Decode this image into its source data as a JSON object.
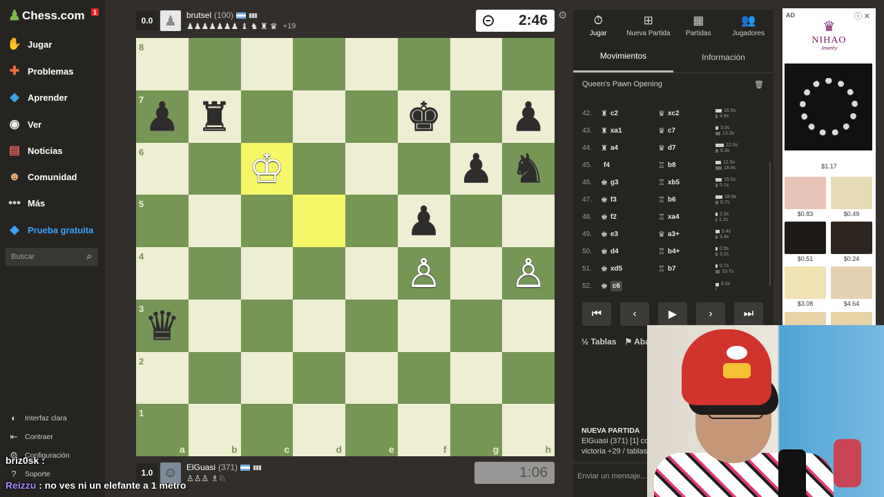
{
  "sidebar": {
    "brand": "Chess.com",
    "notification_count": "1",
    "nav": [
      {
        "label": "Jugar",
        "icon": "play-hand-icon"
      },
      {
        "label": "Problemas",
        "icon": "puzzle-icon"
      },
      {
        "label": "Aprender",
        "icon": "learn-cube-icon"
      },
      {
        "label": "Ver",
        "icon": "binoculars-icon"
      },
      {
        "label": "Noticias",
        "icon": "news-icon"
      },
      {
        "label": "Comunidad",
        "icon": "community-icon"
      },
      {
        "label": "Más",
        "icon": "more-dots-icon"
      },
      {
        "label": "Prueba gratuita",
        "icon": "diamond-icon"
      }
    ],
    "search_placeholder": "Buscar",
    "bottom": [
      {
        "label": "Interfaz clara",
        "icon": "theme-toggle-icon"
      },
      {
        "label": "Contraer",
        "icon": "collapse-icon"
      },
      {
        "label": "Configuración",
        "icon": "settings-icon"
      },
      {
        "label": "Soporte",
        "icon": "help-icon"
      }
    ]
  },
  "chat_overlay": [
    {
      "user": "briz0sk",
      "text": ""
    },
    {
      "user": "Reizzu",
      "text": "no ves ni un elefante a 1 metro"
    }
  ],
  "top_player": {
    "score": "0.0",
    "name": "brutsel",
    "rating": "(100)",
    "captured": "♟♟♟♟♟♟♟ ♝ ♞ ♜ ♛",
    "advantage": "+19",
    "clock": "2:46"
  },
  "bottom_player": {
    "score": "1.0",
    "name": "ElGuasi",
    "rating": "(371)",
    "captured": "♙♙♙ ♗♘",
    "clock": "1:06"
  },
  "board": {
    "ranks": [
      "8",
      "7",
      "6",
      "5",
      "4",
      "3",
      "2",
      "1"
    ],
    "files": [
      "a",
      "b",
      "c",
      "d",
      "e",
      "f",
      "g",
      "h"
    ],
    "highlight": [
      "c6",
      "d5"
    ],
    "pieces": {
      "a7": "♟",
      "b7": "♜",
      "f7": "♚",
      "h7": "♟",
      "c6": "♔",
      "g6": "♟",
      "h6": "♞",
      "f5": "♟",
      "f4": "♙",
      "h4": "♙",
      "a3": "♛"
    },
    "white_squares": [
      "c6",
      "f4",
      "h4"
    ]
  },
  "panel": {
    "tabs": [
      {
        "label": "Jugar",
        "icon": "stopwatch-icon"
      },
      {
        "label": "Nueva Partida",
        "icon": "plus-icon"
      },
      {
        "label": "Partidas",
        "icon": "games-grid-icon"
      },
      {
        "label": "Jugadores",
        "icon": "players-icon"
      }
    ],
    "subtabs": [
      "Movimientos",
      "Información"
    ],
    "opening": "Queen's Pawn Opening",
    "moves": [
      {
        "n": "42.",
        "w": "c2",
        "wp": "♜",
        "b": "xc2",
        "bp": "♛",
        "wt": "16.5s",
        "bt": "4.8s",
        "wb": 7,
        "bb": 2
      },
      {
        "n": "43.",
        "w": "xa1",
        "wp": "♜",
        "b": "c7",
        "bp": "♛",
        "wt": "3.0s",
        "bt": "13.3s",
        "wb": 2,
        "bb": 6
      },
      {
        "n": "44.",
        "w": "a4",
        "wp": "♜",
        "b": "d7",
        "bp": "♛",
        "wt": "22.0s",
        "bt": "6.3s",
        "wb": 10,
        "bb": 3
      },
      {
        "n": "45.",
        "w": "f4",
        "wp": "",
        "b": "b8",
        "bp": "♖",
        "wt": "12.9s",
        "bt": "18.4s",
        "wb": 6,
        "bb": 8
      },
      {
        "n": "46.",
        "w": "g3",
        "wp": "♚",
        "b": "xb5",
        "bp": "♖",
        "wt": "15.5s",
        "bt": "5.1s",
        "wb": 7,
        "bb": 2
      },
      {
        "n": "47.",
        "w": "f3",
        "wp": "♚",
        "b": "b6",
        "bp": "♖",
        "wt": "18.9s",
        "bt": "6.7s",
        "wb": 8,
        "bb": 3
      },
      {
        "n": "48.",
        "w": "f2",
        "wp": "♚",
        "b": "xa4",
        "bp": "♖",
        "wt": "2.3s",
        "bt": "1.2s",
        "wb": 1,
        "bb": 1
      },
      {
        "n": "49.",
        "w": "e3",
        "wp": "♚",
        "b": "a3+",
        "bp": "♛",
        "wt": "9.4s",
        "bt": "3.4s",
        "wb": 4,
        "bb": 2
      },
      {
        "n": "50.",
        "w": "d4",
        "wp": "♚",
        "b": "b4+",
        "bp": "♖",
        "wt": "0.9s",
        "bt": "3.2s",
        "wb": 1,
        "bb": 2
      },
      {
        "n": "51.",
        "w": "xd5",
        "wp": "♚",
        "b": "b7",
        "bp": "♖",
        "wt": "0.7s",
        "bt": "10.7s",
        "wb": 1,
        "bb": 5
      },
      {
        "n": "52.",
        "w": "c6",
        "wp": "♚",
        "b": "",
        "bp": "",
        "wt": "6.0s",
        "bt": "",
        "wb": 3,
        "bb": 0,
        "current": true
      }
    ],
    "actions": [
      {
        "label": "Tablas",
        "icon": "half-icon"
      },
      {
        "label": "Abandonar",
        "icon": "flag-icon"
      }
    ],
    "new_game": {
      "title": "NUEVA PARTIDA",
      "line1": "ElGuasi (371) [1] con",
      "line2": "victoria +29 / tablas"
    },
    "chat_placeholder": "Enviar un mensaje..."
  },
  "ad": {
    "label": "AD",
    "brand": "NIHAO",
    "brand_sub": "Jewelry",
    "hero_price": "$1.17",
    "thumbs": [
      {
        "price": "$0.83",
        "color": "#e9c3b5"
      },
      {
        "price": "$0.49",
        "color": "#e8dcb5"
      },
      {
        "price": "$0.51",
        "color": "#1d1a16"
      },
      {
        "price": "$0.24",
        "color": "#2d2520"
      },
      {
        "price": "$3.08",
        "color": "#f0e2b3"
      },
      {
        "price": "$4.64",
        "color": "#e5d2b0"
      }
    ]
  }
}
